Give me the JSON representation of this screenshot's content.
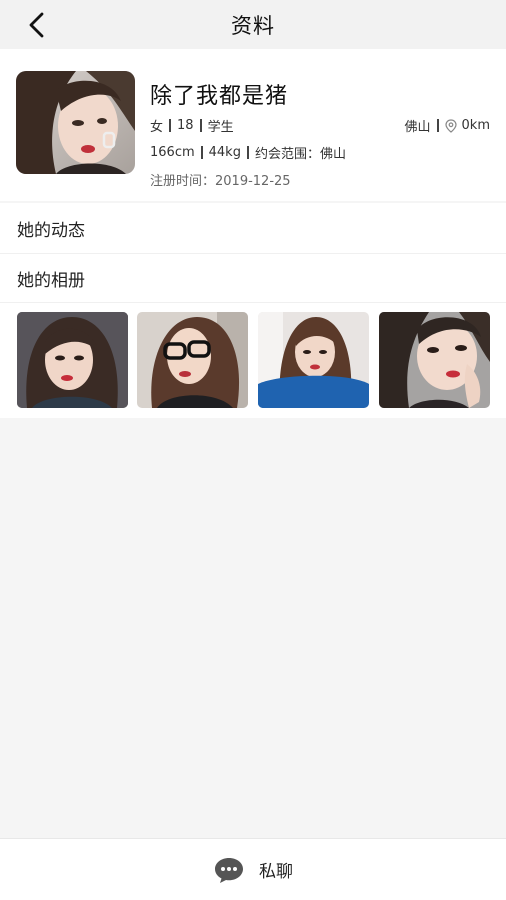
{
  "header": {
    "title": "资料"
  },
  "profile": {
    "name": "除了我都是猪",
    "gender": "女",
    "age": "18",
    "occupation": "学生",
    "height": "166cm",
    "weight": "44kg",
    "date_range": "约会范围：佛山",
    "register": "注册时间：2019-12-25",
    "city": "佛山",
    "distance": "0km"
  },
  "menu": {
    "dynamics": "她的动态",
    "album": "她的相册"
  },
  "footer": {
    "chat_label": "私聊"
  },
  "colors": {
    "accent": "#444444",
    "background": "#f5f5f5",
    "header": "#f2f2f2"
  },
  "icons": [
    "back-arrow-icon",
    "location-pin-icon",
    "chat-bubble-icon"
  ]
}
